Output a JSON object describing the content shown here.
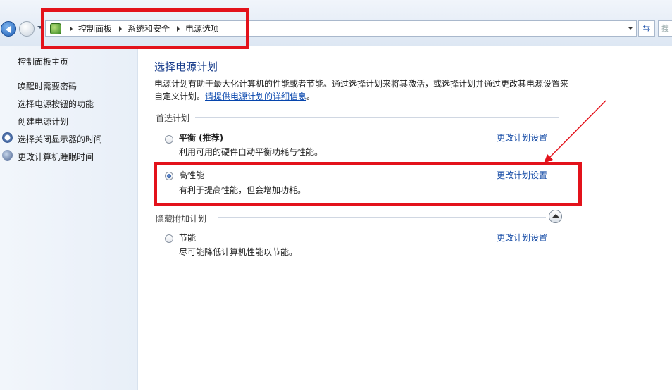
{
  "breadcrumb": {
    "items": [
      "控制面板",
      "系统和安全",
      "电源选项"
    ]
  },
  "search": {
    "placeholder": "搜"
  },
  "sidebar": {
    "home": "控制面板主页",
    "items": [
      {
        "label": "唤醒时需要密码",
        "icon": ""
      },
      {
        "label": "选择电源按钮的功能",
        "icon": ""
      },
      {
        "label": "创建电源计划",
        "icon": ""
      },
      {
        "label": "选择关闭显示器的时间",
        "icon": "clock-icon"
      },
      {
        "label": "更改计算机睡眠时间",
        "icon": "moon-icon"
      }
    ]
  },
  "main": {
    "title": "选择电源计划",
    "description": "电源计划有助于最大化计算机的性能或者节能。通过选择计划来将其激活，或选择计划并通过更改其电源设置来自定义计划。",
    "description_link": "请提供电源计划的详细信息",
    "description_end": "。",
    "preferred_label": "首选计划",
    "hidden_label": "隐藏附加计划",
    "plans": [
      {
        "name": "平衡 (推荐)",
        "desc": "利用可用的硬件自动平衡功耗与性能。",
        "link": "更改计划设置",
        "selected": false
      },
      {
        "name": "高性能",
        "desc": "有利于提高性能，但会增加功耗。",
        "link": "更改计划设置",
        "selected": true
      },
      {
        "name": "节能",
        "desc": "尽可能降低计算机性能以节能。",
        "link": "更改计划设置",
        "selected": false
      }
    ]
  },
  "colors": {
    "highlight": "#e3121b",
    "title": "#1a3e8c",
    "link": "#1a4fa8"
  }
}
